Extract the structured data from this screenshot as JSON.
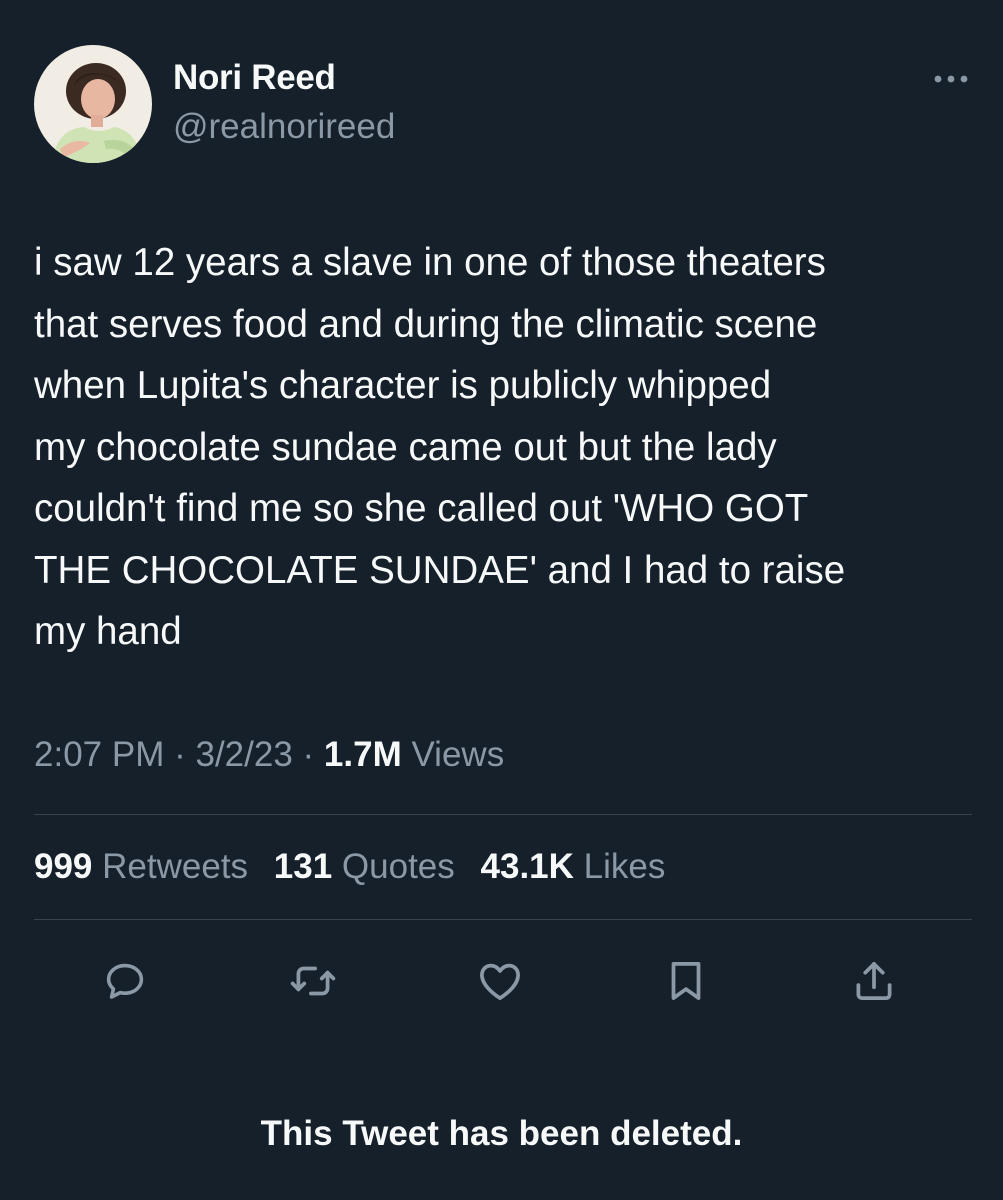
{
  "author": {
    "display_name": "Nori Reed",
    "handle": "@realnorireed"
  },
  "tweet": {
    "text": "i saw 12 years a slave in one of those theaters\nthat serves food and during the climatic scene\nwhen Lupita's character is publicly whipped\nmy chocolate sundae came out but the lady\ncouldn't find me so she called out 'WHO GOT\nTHE CHOCOLATE SUNDAE' and I had to raise\nmy hand",
    "time": "2:07 PM",
    "date": "3/2/23",
    "separator": "·",
    "views_count": "1.7M",
    "views_label": "Views"
  },
  "stats": {
    "retweets_count": "999",
    "retweets_label": "Retweets",
    "quotes_count": "131",
    "quotes_label": "Quotes",
    "likes_count": "43.1K",
    "likes_label": "Likes"
  },
  "actions": [
    {
      "icon": "reply-icon"
    },
    {
      "icon": "retweet-icon"
    },
    {
      "icon": "like-icon"
    },
    {
      "icon": "bookmark-icon"
    },
    {
      "icon": "share-icon"
    }
  ],
  "footer": {
    "deleted_notice": "This Tweet has been deleted."
  },
  "colors": {
    "background": "#15202b",
    "primary_text": "#f7f9f9",
    "secondary_text": "#8b98a5",
    "divider": "#38444d",
    "icon": "#8b98a5"
  }
}
